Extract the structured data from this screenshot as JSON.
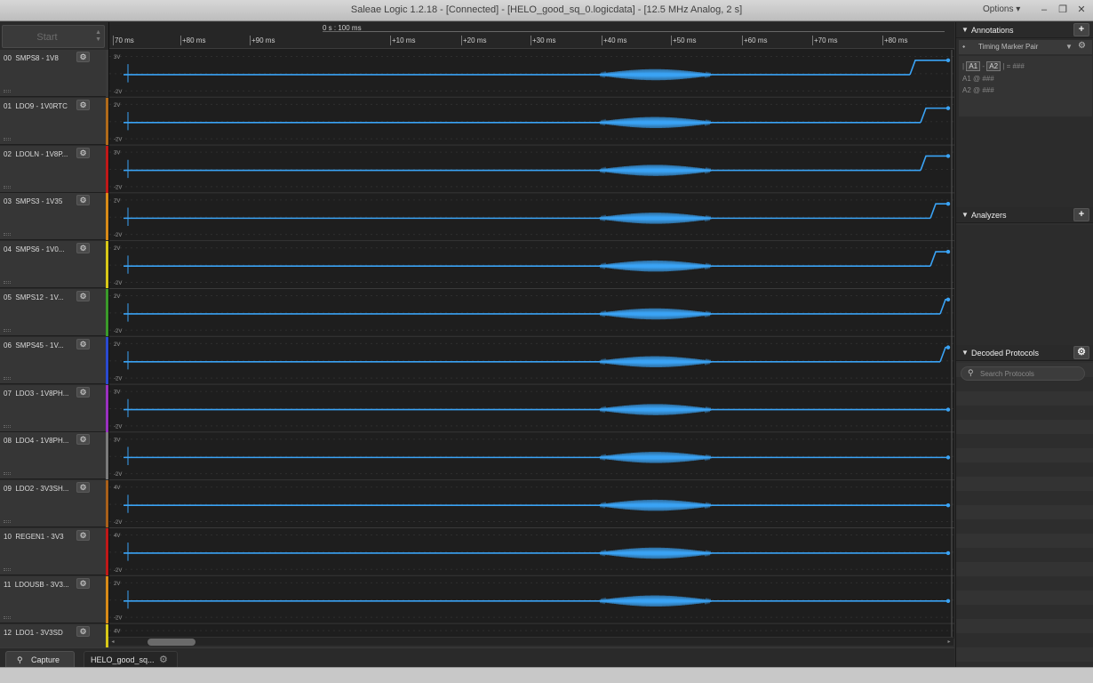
{
  "window": {
    "title": "Saleae Logic 1.2.18 - [Connected] - [HELO_good_sq_0.logicdata] - [12.5 MHz Analog, 2 s]",
    "options_label": "Options ▾",
    "minimize": "–",
    "restore": "❐",
    "close": "✕"
  },
  "start_button": {
    "label": "Start"
  },
  "ruler": {
    "center_label": "0 s : 100 ms",
    "ticks": [
      "70 ms",
      "+80 ms",
      "+90 ms",
      "+10 ms",
      "+20 ms",
      "+30 ms",
      "+40 ms",
      "+50 ms",
      "+60 ms",
      "+70 ms",
      "+80 ms"
    ]
  },
  "channels": [
    {
      "index": "00",
      "name": "SMPS8 - 1V8",
      "color": "#3a3a3a",
      "top_label": "3V",
      "bottom_label": "-2V",
      "step": 0.83
    },
    {
      "index": "01",
      "name": "LDO9 - 1V0RTC",
      "color": "#b06a1a",
      "top_label": "2V",
      "bottom_label": "-2V",
      "step": 0.84
    },
    {
      "index": "02",
      "name": "LDOLN - 1V8P...",
      "color": "#c01818",
      "top_label": "3V",
      "bottom_label": "-2V",
      "step": 0.84
    },
    {
      "index": "03",
      "name": "SMPS3 - 1V35",
      "color": "#d88a18",
      "top_label": "2V",
      "bottom_label": "-2V",
      "step": 0.85
    },
    {
      "index": "04",
      "name": "SMPS6 - 1V0...",
      "color": "#d8c818",
      "top_label": "2V",
      "bottom_label": "-2V",
      "step": 0.85
    },
    {
      "index": "05",
      "name": "SMPS12 - 1V...",
      "color": "#3a9a2a",
      "top_label": "2V",
      "bottom_label": "-2V",
      "step": 0.86
    },
    {
      "index": "06",
      "name": "SMPS45 - 1V...",
      "color": "#2a4ad0",
      "top_label": "2V",
      "bottom_label": "-2V",
      "step": 0.86
    },
    {
      "index": "07",
      "name": "LDO3 - 1V8PH...",
      "color": "#9a30c0",
      "top_label": "3V",
      "bottom_label": "-2V",
      "step": 0.87
    },
    {
      "index": "08",
      "name": "LDO4 - 1V8PH...",
      "color": "#7a7a7a",
      "top_label": "3V",
      "bottom_label": "-2V",
      "step": 0.87
    },
    {
      "index": "09",
      "name": "LDO2 - 3V3SH...",
      "color": "#a8601a",
      "top_label": "4V",
      "bottom_label": "-2V",
      "step": 0.87
    },
    {
      "index": "10",
      "name": "REGEN1 - 3V3",
      "color": "#c01818",
      "top_label": "4V",
      "bottom_label": "-2V",
      "step": 0.88
    },
    {
      "index": "11",
      "name": "LDOUSB - 3V3...",
      "color": "#d88a18",
      "top_label": "2V",
      "bottom_label": "-2V",
      "step": 0
    },
    {
      "index": "12",
      "name": "LDO1 - 3V3SD",
      "color": "#d8c818",
      "top_label": "4V",
      "bottom_label": "",
      "step": 0
    }
  ],
  "tabs": {
    "capture": "Capture",
    "file": "HELO_good_sq..."
  },
  "annotations": {
    "title": "Annotations",
    "add": "+",
    "timing_pair_label": "Timing Marker Pair",
    "formula_open": "|",
    "a1": "A1",
    "minus": "-",
    "a2": "A2",
    "formula_close": "| = ###",
    "a1_row": "A1  @  ###",
    "a2_row": "A2  @  ###"
  },
  "analyzers": {
    "title": "Analyzers",
    "add": "+"
  },
  "decoded": {
    "title": "Decoded Protocols",
    "search_placeholder": "Search Protocols"
  },
  "colors": {
    "trace": "#3aa3f5",
    "background": "#1d1d1d"
  }
}
